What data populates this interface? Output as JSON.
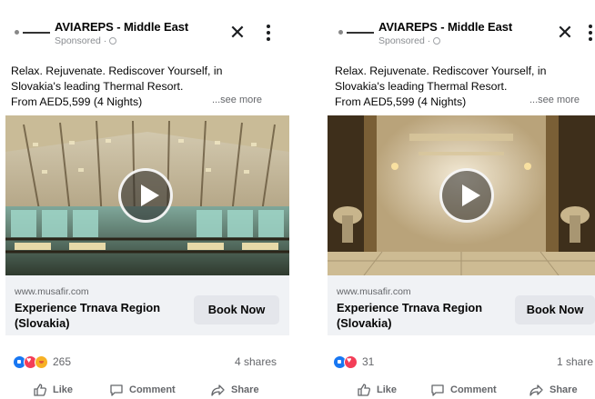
{
  "colors": {
    "card_bg": "#ffffff",
    "cta_bg": "#f0f2f5",
    "button_bg": "#e4e6eb",
    "secondary_text": "#65676b",
    "like_blue": "#1877f2",
    "love_red": "#f33e58",
    "care_yellow": "#f7b125"
  },
  "posts": [
    {
      "advertiser": "AVIAREPS - Middle East",
      "sponsored_label": "Sponsored ·",
      "caption_lines": [
        "Relax. Rejuvenate. Rediscover Yourself, in",
        "Slovakia's leading Thermal Resort.",
        "From AED5,599 (4 Nights)"
      ],
      "see_more": "...see more",
      "media_icon": "play-icon",
      "cta": {
        "url": "www.musafir.com",
        "title": "Experience Trnava Region (Slovakia)",
        "button": "Book Now"
      },
      "reaction_icons": [
        "like-icon",
        "love-icon",
        "care-icon"
      ],
      "reaction_count": "265",
      "shares": "4 shares",
      "actions": {
        "like": "Like",
        "comment": "Comment",
        "share": "Share"
      }
    },
    {
      "advertiser": "AVIAREPS - Middle East",
      "sponsored_label": "Sponsored ·",
      "caption_lines": [
        "Relax. Rejuvenate. Rediscover Yourself, in",
        "Slovakia's leading Thermal Resort.",
        "From AED5,599 (4 Nights)"
      ],
      "see_more": "...see more",
      "media_icon": "play-icon",
      "cta": {
        "url": "www.musafir.com",
        "title": "Experience Trnava Region (Slovakia)",
        "button": "Book Now"
      },
      "reaction_icons": [
        "like-icon",
        "love-icon"
      ],
      "reaction_count": "31",
      "shares": "1 share",
      "actions": {
        "like": "Like",
        "comment": "Comment",
        "share": "Share"
      }
    }
  ]
}
